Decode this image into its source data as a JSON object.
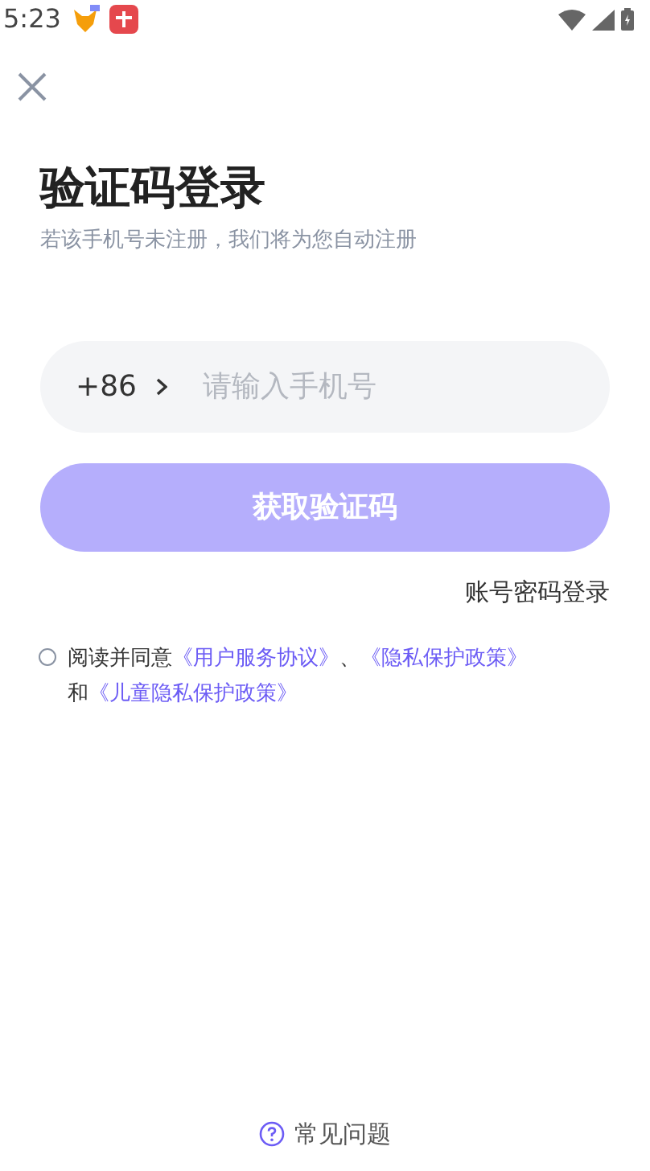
{
  "status_bar": {
    "time": "5:23"
  },
  "title": "验证码登录",
  "subtitle": "若该手机号未注册，我们将为您自动注册",
  "phone": {
    "country_code": "+86",
    "placeholder": "请输入手机号"
  },
  "submit": {
    "label": "获取验证码",
    "disabled": true
  },
  "alt_login": "账号密码登录",
  "agreement": {
    "checked": false,
    "lines": [
      [
        {
          "kind": "text",
          "text": "阅读并同意"
        },
        {
          "kind": "link",
          "text": "《用户服务协议》"
        },
        {
          "kind": "text",
          "text": "、"
        },
        {
          "kind": "link",
          "text": "《隐私保护政策》"
        }
      ],
      [
        {
          "kind": "text",
          "text": "和"
        },
        {
          "kind": "link",
          "text": "《儿童隐私保护政策》"
        }
      ]
    ]
  },
  "faq": "常见问题"
}
